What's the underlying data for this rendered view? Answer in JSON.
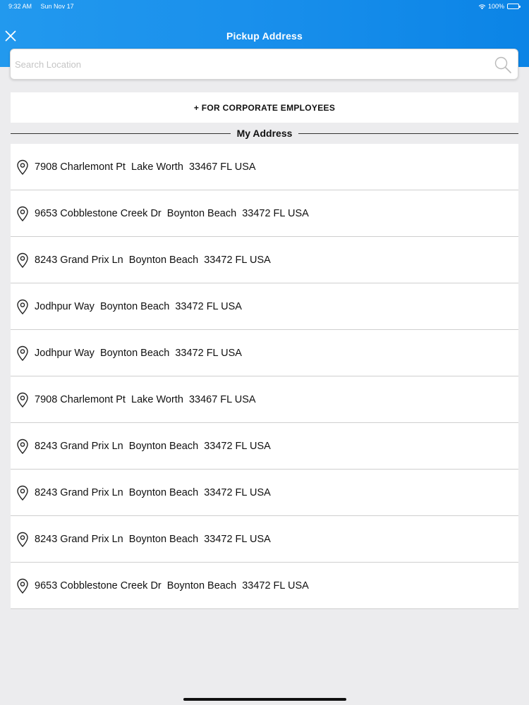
{
  "status_bar": {
    "time": "9:32 AM",
    "date": "Sun Nov 17",
    "battery": "100%"
  },
  "header": {
    "title": "Pickup Address",
    "close_icon": "close-icon"
  },
  "search": {
    "placeholder": "Search Location",
    "value": "",
    "icon": "search-icon"
  },
  "corporate_button": {
    "label": "+ FOR CORPORATE EMPLOYEES"
  },
  "section": {
    "title": "My Address"
  },
  "addresses": [
    "7908 Charlemont Pt  Lake Worth  33467 FL USA",
    "9653 Cobblestone Creek Dr  Boynton Beach  33472 FL USA",
    "8243 Grand Prix Ln  Boynton Beach  33472 FL USA",
    "Jodhpur Way  Boynton Beach  33472 FL USA",
    "Jodhpur Way  Boynton Beach  33472 FL USA",
    "7908 Charlemont Pt  Lake Worth  33467 FL USA",
    "8243 Grand Prix Ln  Boynton Beach  33472 FL USA",
    "8243 Grand Prix Ln  Boynton Beach  33472 FL USA",
    "8243 Grand Prix Ln  Boynton Beach  33472 FL USA",
    "9653 Cobblestone Creek Dr  Boynton Beach  33472 FL USA"
  ],
  "colors": {
    "header_start": "#2299ee",
    "header_end": "#0b84e6",
    "background": "#ececee"
  }
}
